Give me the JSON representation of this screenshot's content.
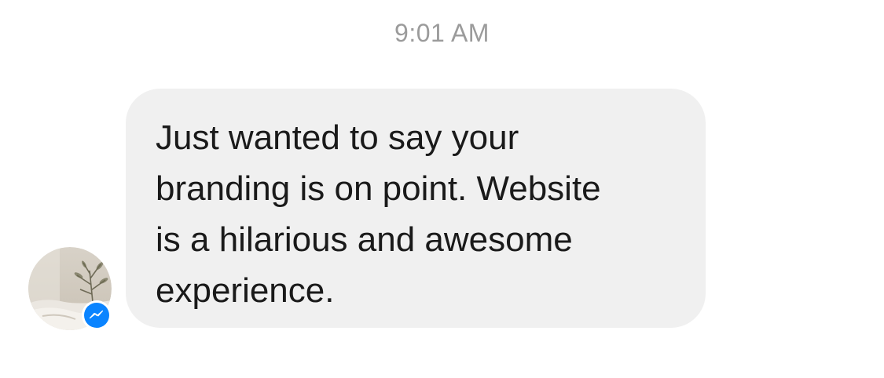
{
  "timestamp": "9:01 AM",
  "message": {
    "text": "Just wanted to say your\nbranding is on point. Website\nis a hilarious and awesome\nexperience."
  },
  "sender": {
    "avatar_icon": "profile-photo",
    "badge_icon": "messenger-icon"
  },
  "colors": {
    "bubble": "#f0f0f0",
    "timestamp": "#9b9b9b",
    "text": "#1a1a1a",
    "messenger_blue": "#0a84ff"
  }
}
